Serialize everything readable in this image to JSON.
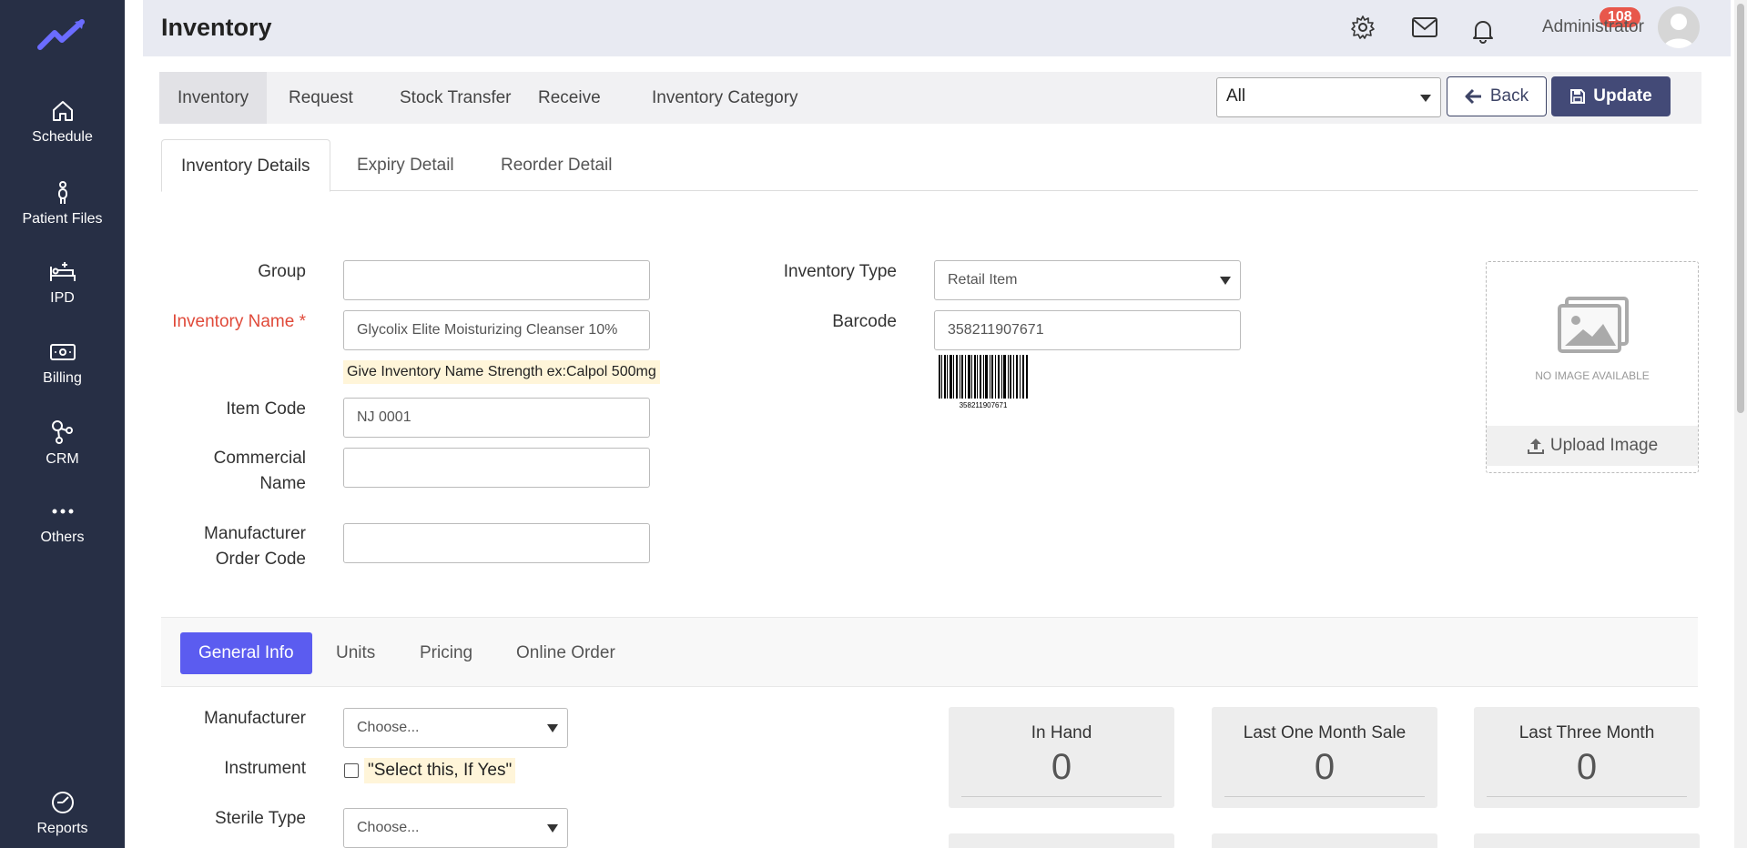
{
  "sidebar": {
    "items": [
      {
        "label": "Schedule",
        "icon": "home-icon"
      },
      {
        "label": "Patient Files",
        "icon": "person-icon"
      },
      {
        "label": "IPD",
        "icon": "bed-icon"
      },
      {
        "label": "Billing",
        "icon": "money-icon"
      },
      {
        "label": "CRM",
        "icon": "network-icon"
      },
      {
        "label": "Others",
        "icon": "more-icon"
      },
      {
        "label": "Reports",
        "icon": "reports-icon"
      }
    ]
  },
  "header": {
    "title": "Inventory",
    "notification_count": "108",
    "user_name": "Administrator"
  },
  "top_tabs": [
    "Inventory",
    "Request",
    "Stock Transfer",
    "Receive",
    "Inventory Category"
  ],
  "toolbar": {
    "filter_value": "All",
    "back_label": "Back",
    "update_label": "Update"
  },
  "detail_tabs": [
    "Inventory Details",
    "Expiry Detail",
    "Reorder Detail"
  ],
  "form": {
    "group_label": "Group",
    "group_value": "",
    "name_label": "Inventory Name *",
    "name_value": "Glycolix Elite Moisturizing Cleanser 10%",
    "name_hint": "Give Inventory Name Strength ex:Calpol 500mg",
    "item_code_label": "Item Code",
    "item_code_value": "NJ 0001",
    "commercial_label_1": "Commercial",
    "commercial_label_2": "Name",
    "commercial_value": "",
    "mfr_order_label_1": "Manufacturer",
    "mfr_order_label_2": "Order Code",
    "mfr_order_value": "",
    "type_label": "Inventory Type",
    "type_value": "Retail Item",
    "barcode_label": "Barcode",
    "barcode_value": "358211907671",
    "barcode_caption": "358211907671"
  },
  "image": {
    "no_image_text": "NO IMAGE AVAILABLE",
    "upload_label": "Upload Image"
  },
  "general_tabs": [
    "General Info",
    "Units",
    "Pricing",
    "Online Order"
  ],
  "general": {
    "manufacturer_label": "Manufacturer",
    "manufacturer_value": "Choose...",
    "instrument_label": "Instrument",
    "instrument_note": "\"Select this, If Yes\"",
    "sterile_label": "Sterile Type",
    "sterile_value": "Choose..."
  },
  "stats": [
    {
      "title": "In Hand",
      "value": "0"
    },
    {
      "title": "Last One Month Sale",
      "value": "0"
    },
    {
      "title": "Last Three Month",
      "value": "0"
    }
  ],
  "colors": {
    "sidebar_bg": "#272f45",
    "accent": "#5b5cf0",
    "primary_button": "#434a77",
    "required": "#e04a3a",
    "badge": "#e8574b"
  }
}
